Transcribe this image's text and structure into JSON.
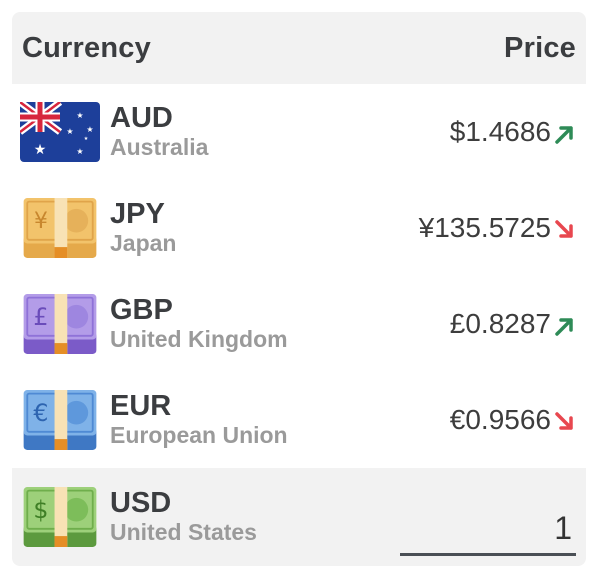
{
  "header": {
    "currency_label": "Currency",
    "price_label": "Price"
  },
  "rows": [
    {
      "code": "AUD",
      "country": "Australia",
      "price": "$1.4686",
      "trend": "up"
    },
    {
      "code": "JPY",
      "country": "Japan",
      "price": "¥135.5725",
      "trend": "down"
    },
    {
      "code": "GBP",
      "country": "United Kingdom",
      "price": "£0.8287",
      "trend": "up"
    },
    {
      "code": "EUR",
      "country": "European Union",
      "price": "€0.9566",
      "trend": "down"
    }
  ],
  "base": {
    "code": "USD",
    "country": "United States",
    "amount": "1"
  },
  "colors": {
    "up": "#2e8b57",
    "down": "#e8474f"
  }
}
